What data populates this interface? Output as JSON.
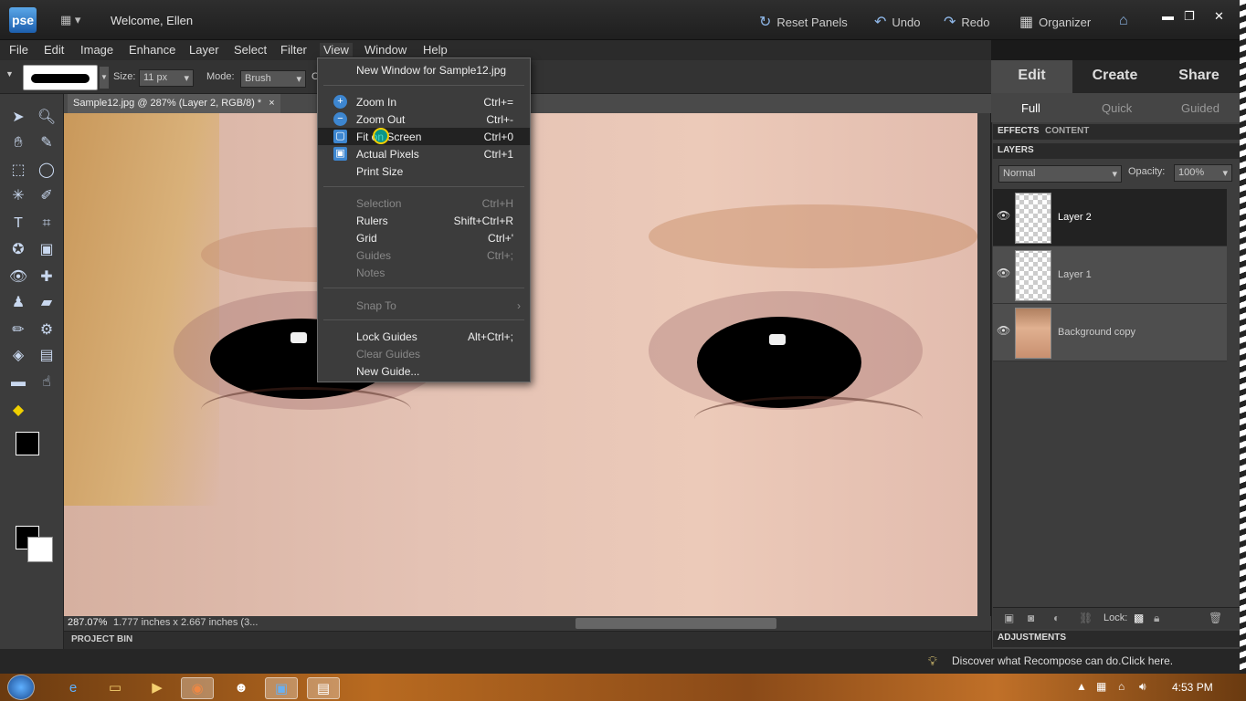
{
  "app": {
    "logo_text": "pse",
    "welcome": "Welcome, Ellen"
  },
  "titlebar": {
    "reset_panels": "Reset Panels",
    "undo": "Undo",
    "redo": "Redo",
    "organizer": "Organizer",
    "minimize": "▬",
    "restore": "❐",
    "close": "✕"
  },
  "menubar": [
    "File",
    "Edit",
    "Image",
    "Enhance",
    "Layer",
    "Select",
    "Filter",
    "View",
    "Window",
    "Help"
  ],
  "options": {
    "size_label": "Size:",
    "size_value": "11 px",
    "mode_label": "Mode:",
    "mode_value": "Brush",
    "trunc": "O"
  },
  "document": {
    "tab_title": "Sample12.jpg @ 287% (Layer 2, RGB/8) *",
    "tab_close": "×",
    "zoom": "287.07%",
    "dims": "1.777 inches x 2.667 inches (3..."
  },
  "project_bin": "PROJECT BIN",
  "view_menu": [
    {
      "label": "New Window for Sample12.jpg",
      "shortcut": "",
      "state": "normal",
      "icon": ""
    },
    {
      "label": "Zoom In",
      "shortcut": "Ctrl+=",
      "state": "normal",
      "icon": "zoom-in-icon"
    },
    {
      "label": "Zoom Out",
      "shortcut": "Ctrl+-",
      "state": "normal",
      "icon": "zoom-out-icon"
    },
    {
      "label": "Fit on Screen",
      "shortcut": "Ctrl+0",
      "state": "highlight",
      "icon": "fit-screen-icon"
    },
    {
      "label": "Actual Pixels",
      "shortcut": "Ctrl+1",
      "state": "normal",
      "icon": "actual-pixels-icon"
    },
    {
      "label": "Print Size",
      "shortcut": "",
      "state": "normal",
      "icon": ""
    },
    {
      "label": "Selection",
      "shortcut": "Ctrl+H",
      "state": "disabled",
      "icon": ""
    },
    {
      "label": "Rulers",
      "shortcut": "Shift+Ctrl+R",
      "state": "normal",
      "icon": ""
    },
    {
      "label": "Grid",
      "shortcut": "Ctrl+'",
      "state": "normal",
      "icon": ""
    },
    {
      "label": "Guides",
      "shortcut": "Ctrl+;",
      "state": "disabled",
      "icon": ""
    },
    {
      "label": "Notes",
      "shortcut": "",
      "state": "disabled",
      "icon": ""
    },
    {
      "label": "Snap To",
      "shortcut": "›",
      "state": "disabled",
      "icon": ""
    },
    {
      "label": "Lock Guides",
      "shortcut": "Alt+Ctrl+;",
      "state": "normal",
      "icon": ""
    },
    {
      "label": "Clear Guides",
      "shortcut": "",
      "state": "disabled",
      "icon": ""
    },
    {
      "label": "New Guide...",
      "shortcut": "",
      "state": "normal",
      "icon": ""
    }
  ],
  "right_panel": {
    "modes": [
      "Edit",
      "Create",
      "Share"
    ],
    "submodes": [
      "Full",
      "Quick",
      "Guided"
    ],
    "effects_tab": "EFFECTS",
    "content_tab": "CONTENT",
    "layers_title": "LAYERS",
    "blend_mode": "Normal",
    "opacity_label": "Opacity:",
    "opacity_value": "100%",
    "layers": [
      {
        "name": "Layer 2",
        "selected": true
      },
      {
        "name": "Layer 1",
        "selected": false
      },
      {
        "name": "Background copy",
        "selected": false
      }
    ],
    "lock_label": "Lock:",
    "adjustments": "ADJUSTMENTS"
  },
  "info_bar": "Discover what Recompose can do.Click here.",
  "taskbar": {
    "clock": "4:53 PM"
  }
}
